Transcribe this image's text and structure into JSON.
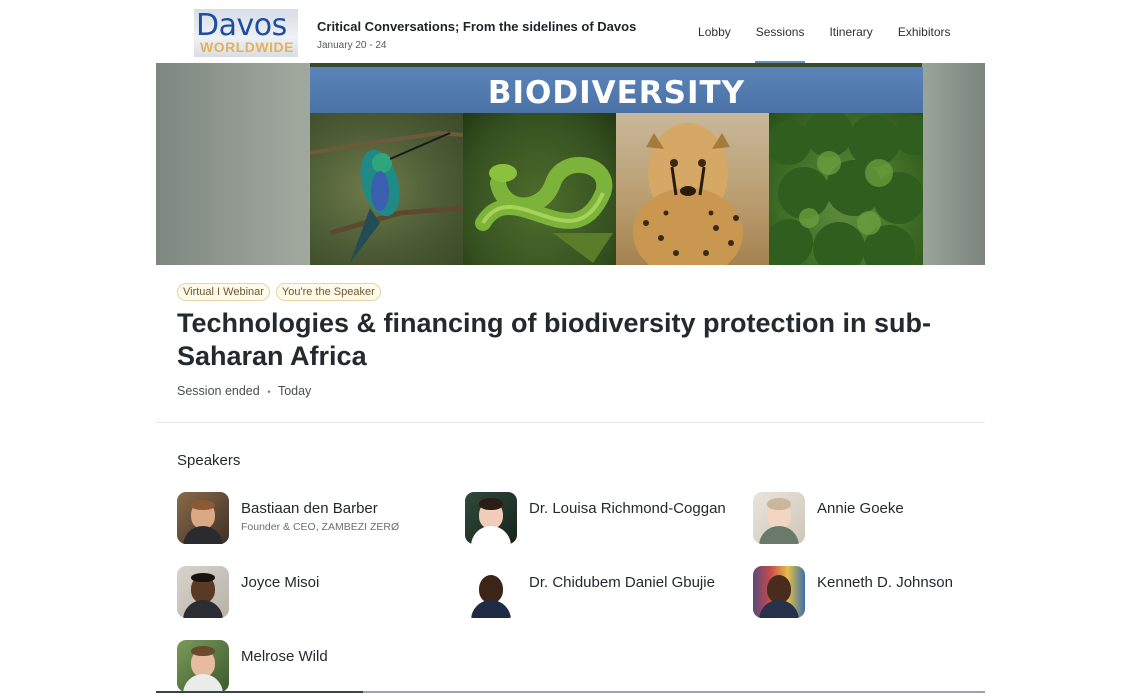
{
  "header": {
    "logo_top": "Davos",
    "logo_bottom": "WORLDWIDE",
    "event_title": "Critical Conversations; From the sidelines of Davos",
    "event_dates": "January 20 - 24",
    "nav": [
      {
        "label": "Lobby",
        "active": false
      },
      {
        "label": "Sessions",
        "active": true
      },
      {
        "label": "Itinerary",
        "active": false
      },
      {
        "label": "Exhibitors",
        "active": false
      }
    ]
  },
  "banner": {
    "title": "BIODIVERSITY"
  },
  "session": {
    "tags": [
      "Virtual I Webinar",
      "You're the Speaker"
    ],
    "title": "Technologies & financing of biodiversity protection in sub-Saharan Africa",
    "status": "Session ended",
    "separator": "•",
    "when": "Today"
  },
  "speakers_heading": "Speakers",
  "speakers": [
    {
      "name": "Bastiaan den Barber",
      "role": "Founder & CEO, ZAMBEZI ZERØ"
    },
    {
      "name": "Dr. Louisa Richmond-Coggan",
      "role": ""
    },
    {
      "name": "Annie Goeke",
      "role": ""
    },
    {
      "name": "Joyce Misoi",
      "role": ""
    },
    {
      "name": "Dr. Chidubem Daniel Gbujie",
      "role": ""
    },
    {
      "name": "Kenneth D. Johnson",
      "role": ""
    },
    {
      "name": "Melrose Wild",
      "role": ""
    }
  ],
  "colors": {
    "accent": "#6b90b8",
    "tag_border": "#e7d3a5",
    "tag_bg": "#fff9ea",
    "banner_bar": "#4f78ad"
  }
}
